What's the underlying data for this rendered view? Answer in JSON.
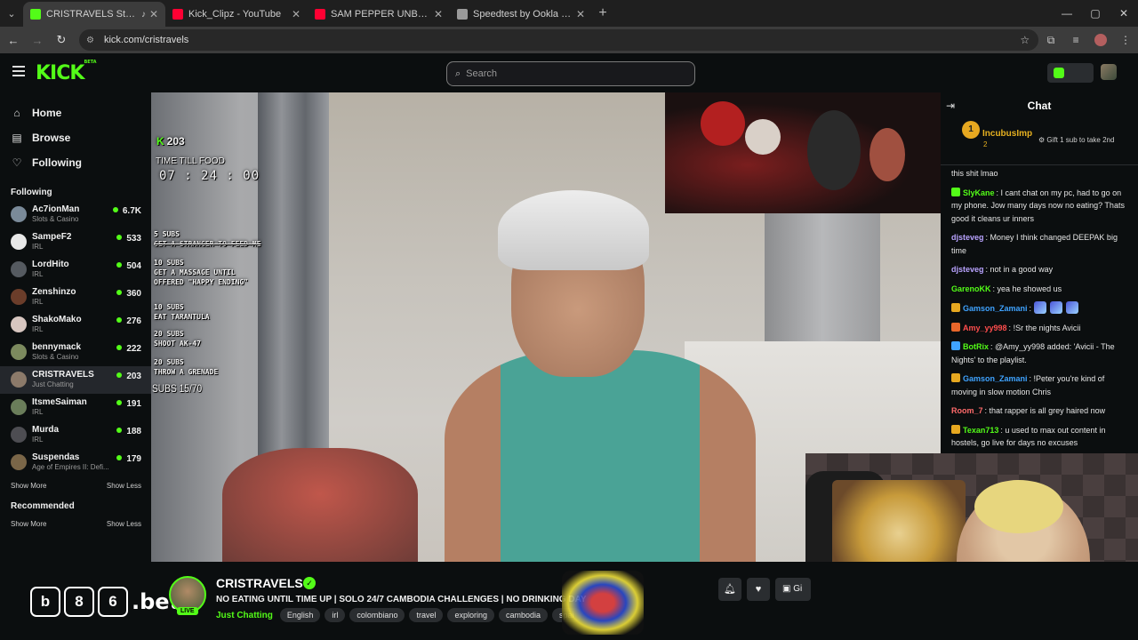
{
  "browser": {
    "tabs": [
      {
        "title": "CRISTRAVELS Stream - Watc",
        "favicon_color": "#53fc18",
        "active": true
      },
      {
        "title": "Kick_Clipz - YouTube",
        "favicon_color": "#ff0033",
        "active": false
      },
      {
        "title": "SAM PEPPER UNBANNED + ST",
        "favicon_color": "#ff0033",
        "active": false
      },
      {
        "title": "Speedtest by Ookla - The Glob",
        "favicon_color": "#9a9a9a",
        "active": false
      }
    ],
    "url": "kick.com/cristravels"
  },
  "kick": {
    "logo": "KICK",
    "logo_badge": "BETA",
    "search_placeholder": "Search"
  },
  "sidebar": {
    "nav": [
      {
        "label": "Home",
        "icon": "home-icon"
      },
      {
        "label": "Browse",
        "icon": "browse-icon"
      },
      {
        "label": "Following",
        "icon": "heart-icon"
      }
    ],
    "following_title": "Following",
    "channels": [
      {
        "name": "Ac7ionMan",
        "category": "Slots & Casino",
        "viewers": "6.7K",
        "avatar": "#7a8a99"
      },
      {
        "name": "SampeF2",
        "category": "IRL",
        "viewers": "533",
        "avatar": "#e8e8e8"
      },
      {
        "name": "LordHito",
        "category": "IRL",
        "viewers": "504",
        "avatar": "#555a60"
      },
      {
        "name": "Zenshinzo",
        "category": "IRL",
        "viewers": "360",
        "avatar": "#6b3d2a"
      },
      {
        "name": "ShakoMako",
        "category": "IRL",
        "viewers": "276",
        "avatar": "#d7c6c0"
      },
      {
        "name": "bennymack",
        "category": "Slots & Casino",
        "viewers": "222",
        "avatar": "#7c8a5e"
      },
      {
        "name": "CRISTRAVELS",
        "category": "Just Chatting",
        "viewers": "203",
        "avatar": "#8c7a6a",
        "selected": true
      },
      {
        "name": "ItsmeSaiman",
        "category": "IRL",
        "viewers": "191",
        "avatar": "#6a7d5a"
      },
      {
        "name": "Murda",
        "category": "IRL",
        "viewers": "188",
        "avatar": "#4d4d52"
      },
      {
        "name": "Suspendas",
        "category": "Age of Empires II: Defi...",
        "viewers": "179",
        "avatar": "#7a6648"
      }
    ],
    "show_more": "Show More",
    "show_less": "Show Less",
    "recommended_title": "Recommended"
  },
  "overlay": {
    "viewer_count": "203",
    "time_label": "TIME TILL FOOD",
    "timer": "07 : 24 : 00",
    "goals": [
      {
        "subs": "5 SUBS",
        "task": "GET A STRANGER TO FEED ME",
        "done": true
      },
      {
        "subs": "10 SUBS",
        "task": "GET A MASSAGE UNTIL\nOFFERED \"HAPPY ENDING\"",
        "done": false
      },
      {
        "subs": "10 SUBS",
        "task": "EAT TARANTULA",
        "done": false
      },
      {
        "subs": "20 SUBS",
        "task": "SHOOT AK-47",
        "done": false
      },
      {
        "subs": "20 SUBS",
        "task": "THROW A GRENADE",
        "done": false
      }
    ],
    "subs_progress": "SUBS 15/70"
  },
  "chat": {
    "title": "Chat",
    "pinned": {
      "rank": "1",
      "user": "IncubusImp",
      "count": "2",
      "gift_text": "Gift 1 sub to take 2nd"
    },
    "messages": [
      {
        "user": "",
        "color": "#e6e6e6",
        "badge": "",
        "text": "this shit lmao"
      },
      {
        "user": "SlyKane",
        "color": "#53fc18",
        "badge": "#53fc18",
        "text": "I cant chat on my pc, had to go on my phone. Jow many days now no eating? Thats good it cleans ur inners"
      },
      {
        "user": "djsteveg",
        "color": "#b9a3ff",
        "badge": "",
        "text": "Money I think changed DEEPAK big time"
      },
      {
        "user": "djsteveg",
        "color": "#b9a3ff",
        "badge": "",
        "text": "not in a good way"
      },
      {
        "user": "GarenoKK",
        "color": "#53fc18",
        "badge": "",
        "text": "yea he showed us"
      },
      {
        "user": "Gamson_Zamani",
        "color": "#3fa3ff",
        "badge": "#e7a820",
        "text": "",
        "emotes": 3
      },
      {
        "user": "Amy_yy998",
        "color": "#ff4d4d",
        "badge": "#e7662a",
        "text": "!Sr the nights Avicii"
      },
      {
        "user": "BotRix",
        "color": "#53fc18",
        "badge": "#3fa3ff",
        "text": "@Amy_yy998 added: 'Avicii - The Nights' to the playlist."
      },
      {
        "user": "Gamson_Zamani",
        "color": "#3fa3ff",
        "badge": "#e7a820",
        "text": "!Peter you're kind of moving in slow motion Chris"
      },
      {
        "user": "Room_7",
        "color": "#ff6b6b",
        "badge": "",
        "text": "that rapper is all grey haired now"
      },
      {
        "user": "Texan713",
        "color": "#53fc18",
        "badge": "#e7a820",
        "text": "u used to max out content in hostels, go live for days no excuses"
      }
    ]
  },
  "stream": {
    "channel": "CRISTRAVELS",
    "title": "NO EATING UNTIL TIME UP | SOLO 24/7 CAMBODIA CHALLENGES | NO DRINKING DAY",
    "category": "Just Chatting",
    "tags": [
      "English",
      "irl",
      "colombiano",
      "travel",
      "exploring",
      "cambodia",
      "spai"
    ],
    "live_label": "LIVE",
    "sponsor": [
      "b",
      "8",
      "6",
      ".bet"
    ],
    "gift_label": "Gi"
  }
}
